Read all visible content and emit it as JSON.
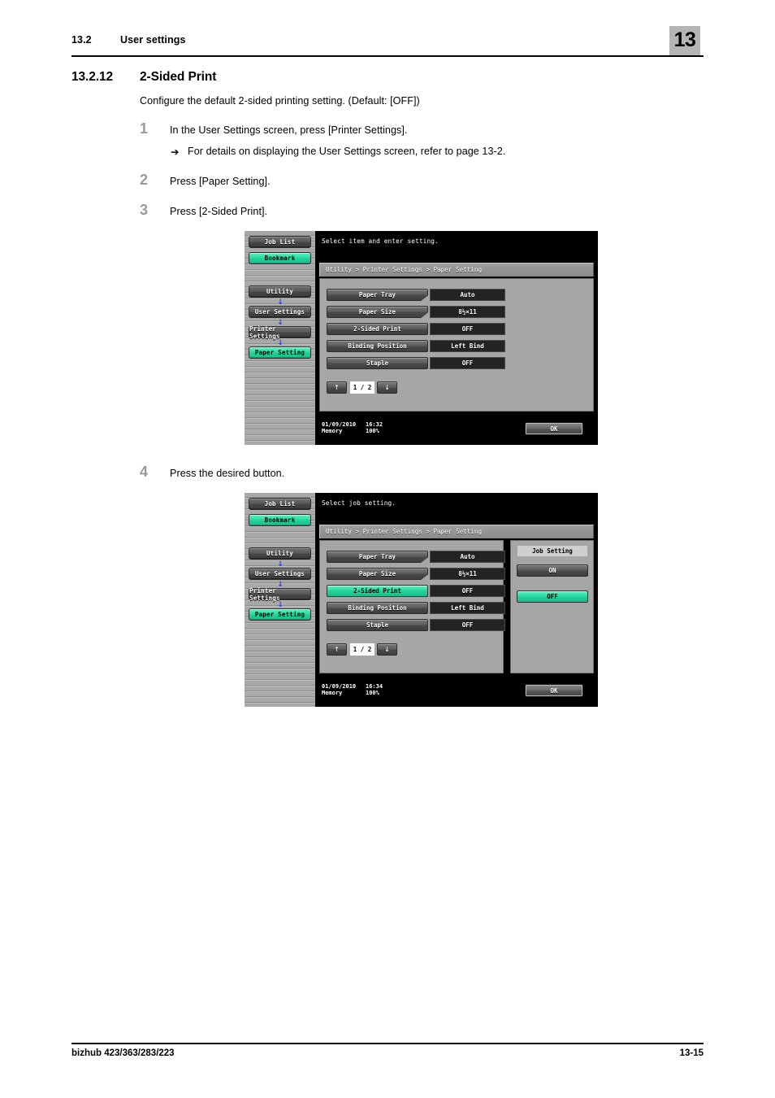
{
  "header": {
    "section_number": "13.2",
    "section_title": "User settings",
    "chapter_tab": "13"
  },
  "section": {
    "number": "13.2.12",
    "title": "2-Sided Print",
    "intro": "Configure the default 2-sided printing setting. (Default: [OFF])"
  },
  "steps": [
    {
      "num": "1",
      "text": "In the User Settings screen, press [Printer Settings].",
      "sub_arrow": "➔",
      "sub_text": "For details on displaying the User Settings screen, refer to page 13-2."
    },
    {
      "num": "2",
      "text": "Press [Paper Setting]."
    },
    {
      "num": "3",
      "text": "Press [2-Sided Print]."
    },
    {
      "num": "4",
      "text": "Press the desired button."
    }
  ],
  "screens": [
    {
      "message": "Select item and enter setting.",
      "breadcrumb": "Utility > Printer Settings > Paper Setting",
      "sidebar": [
        {
          "label": "Job List",
          "style": "gray"
        },
        {
          "label": "Bookmark",
          "style": "green"
        },
        {
          "label": "Utility",
          "style": "gray"
        },
        {
          "label": "User Settings",
          "style": "gray"
        },
        {
          "label": "Printer Settings",
          "style": "gray"
        },
        {
          "label": "Paper Setting",
          "style": "green"
        }
      ],
      "rows": [
        {
          "label": "Paper Tray",
          "value": "Auto",
          "notched": true,
          "selected": false
        },
        {
          "label": "Paper Size",
          "value": "8½×11",
          "notched": true,
          "selected": false
        },
        {
          "label": "2-Sided Print",
          "value": "OFF",
          "notched": false,
          "selected": false
        },
        {
          "label": "Binding Position",
          "value": "Left Bind",
          "notched": false,
          "selected": false
        },
        {
          "label": "Staple",
          "value": "OFF",
          "notched": false,
          "selected": false
        }
      ],
      "pager": {
        "up": "↑",
        "down": "↓",
        "page": "1 / 2"
      },
      "job_panel": null,
      "status": {
        "date": "01/09/2010",
        "time": "16:32",
        "memory_label": "Memory",
        "memory_value": "100%"
      },
      "ok_label": "OK"
    },
    {
      "message": "Select job setting.",
      "breadcrumb": "Utility > Printer Settings > Paper Setting",
      "sidebar": [
        {
          "label": "Job List",
          "style": "gray"
        },
        {
          "label": "Bookmark",
          "style": "green"
        },
        {
          "label": "Utility",
          "style": "gray"
        },
        {
          "label": "User Settings",
          "style": "gray"
        },
        {
          "label": "Printer Settings",
          "style": "gray"
        },
        {
          "label": "Paper Setting",
          "style": "green"
        }
      ],
      "rows": [
        {
          "label": "Paper Tray",
          "value": "Auto",
          "notched": true,
          "selected": false
        },
        {
          "label": "Paper Size",
          "value": "8½×11",
          "notched": true,
          "selected": false
        },
        {
          "label": "2-Sided Print",
          "value": "OFF",
          "notched": false,
          "selected": true
        },
        {
          "label": "Binding Position",
          "value": "Left Bind",
          "notched": false,
          "selected": false
        },
        {
          "label": "Staple",
          "value": "OFF",
          "notched": false,
          "selected": false
        }
      ],
      "pager": {
        "up": "↑",
        "down": "↓",
        "page": "1 / 2"
      },
      "job_panel": {
        "title": "Job Setting",
        "options": [
          {
            "label": "ON",
            "selected": false
          },
          {
            "label": "OFF",
            "selected": true
          }
        ]
      },
      "status": {
        "date": "01/09/2010",
        "time": "16:34",
        "memory_label": "Memory",
        "memory_value": "100%"
      },
      "ok_label": "OK"
    }
  ],
  "footer": {
    "model": "bizhub 423/363/283/223",
    "page_number": "13-15"
  }
}
